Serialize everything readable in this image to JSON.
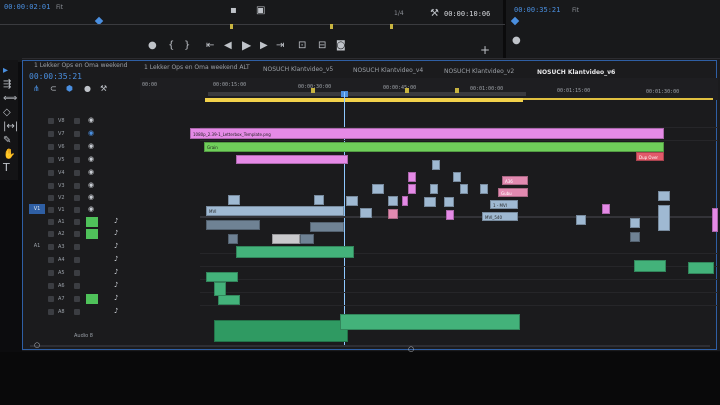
{
  "program_monitor": {
    "timecode_left": "00:00:02:01",
    "fit_label": "Fit",
    "resolution_label": "1/4",
    "timecode_duration": "00:00:10:06"
  },
  "source_monitor": {
    "timecode": "00:00:35:21",
    "fit_label": "Fit"
  },
  "timeline": {
    "timecode": "00:00:35:21",
    "tabs": [
      {
        "label": "1 Lekker Ops en Oma weekend"
      },
      {
        "label": "1 Lekker Ops en Oma weekend ALT"
      },
      {
        "label": "NOSUCH Klantvideo_v5"
      },
      {
        "label": "NOSUCH Klantvideo_v4"
      },
      {
        "label": "NOSUCH Klantvideo_v2"
      },
      {
        "label": "NOSUCH Klantvideo_v6"
      }
    ],
    "ruler_labels": [
      "00:00",
      "00:00:15:00",
      "00:00:30:00",
      "00:00:45:00",
      "00:01:00:00",
      "00:01:15:00",
      "00:01:30:00"
    ],
    "video_tracks": [
      "V8",
      "V7",
      "V6",
      "V5",
      "V4",
      "V3",
      "V2",
      "V1"
    ],
    "audio_tracks": [
      "A1",
      "A2",
      "A3",
      "A4",
      "A5",
      "A6",
      "A7",
      "A8"
    ],
    "source_patch": [
      "V1",
      "A1"
    ],
    "clips": {
      "letterbox": "1080p_2.39-1_Letterbox_Template.png",
      "grain": "Grain",
      "dup_overlay": "Dup Over",
      "a1_label": "A36",
      "a2_label": "Gubu",
      "b_label": "1 - MVI",
      "c_label": "MVI_540",
      "v1_label": "MVI"
    },
    "audio_label_bottom": "Audio 8"
  }
}
